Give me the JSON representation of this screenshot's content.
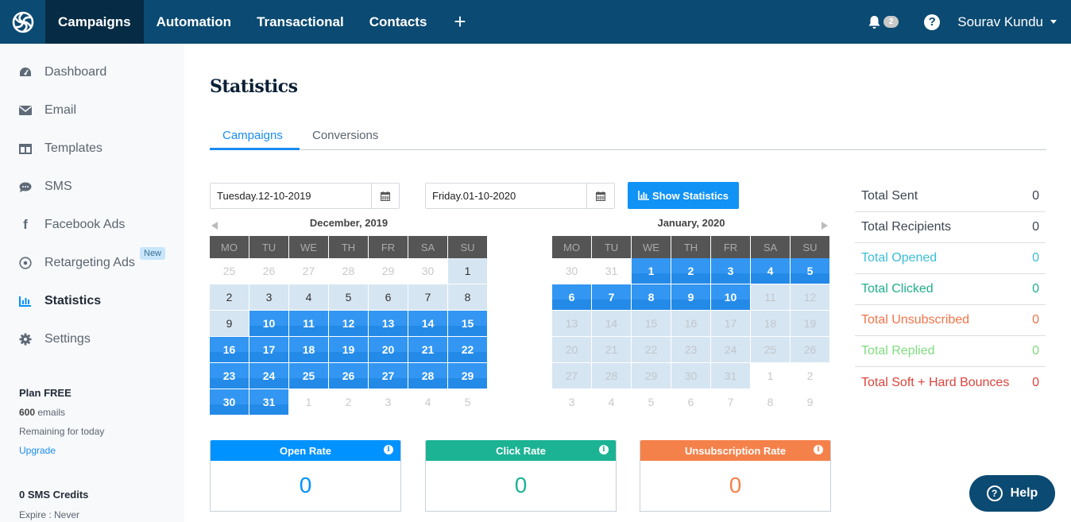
{
  "topnav": {
    "logo": "sendinblue-logo-icon",
    "items": [
      {
        "label": "Campaigns",
        "active": true
      },
      {
        "label": "Automation",
        "active": false
      },
      {
        "label": "Transactional",
        "active": false
      },
      {
        "label": "Contacts",
        "active": false
      }
    ],
    "plus_label": "+",
    "notification_count": "2",
    "user_name": "Sourav Kundu"
  },
  "sidebar": {
    "items": [
      {
        "label": "Dashboard",
        "icon": "dashboard-icon"
      },
      {
        "label": "Email",
        "icon": "envelope-icon"
      },
      {
        "label": "Templates",
        "icon": "templates-icon"
      },
      {
        "label": "SMS",
        "icon": "chat-icon"
      },
      {
        "label": "Facebook Ads",
        "icon": "facebook-icon"
      },
      {
        "label": "Retargeting Ads",
        "icon": "target-icon",
        "badge": "New"
      },
      {
        "label": "Statistics",
        "icon": "bar-chart-icon",
        "active": true
      },
      {
        "label": "Settings",
        "icon": "gear-icon"
      }
    ],
    "plan": {
      "title": "Plan FREE",
      "emails_count": "600",
      "emails_label": " emails",
      "remaining": "Remaining for today",
      "upgrade": "Upgrade"
    },
    "sms": {
      "title": "0 SMS Credits",
      "expire": "Expire : Never"
    }
  },
  "main": {
    "title": "Statistics",
    "tabs": [
      {
        "label": "Campaigns",
        "active": true
      },
      {
        "label": "Conversions",
        "active": false
      }
    ],
    "start_date": "Tuesday.12-10-2019",
    "end_date": "Friday.01-10-2020",
    "show_button": "Show Statistics",
    "calendars": [
      {
        "title": "December, 2019",
        "weekdays": [
          "MO",
          "TU",
          "WE",
          "TH",
          "FR",
          "SA",
          "SU"
        ],
        "days": [
          [
            "25",
            "other"
          ],
          [
            "26",
            "other"
          ],
          [
            "27",
            "other"
          ],
          [
            "28",
            "other"
          ],
          [
            "29",
            "other"
          ],
          [
            "30",
            "other"
          ],
          [
            "1",
            "range"
          ],
          [
            "2",
            "range"
          ],
          [
            "3",
            "range"
          ],
          [
            "4",
            "range"
          ],
          [
            "5",
            "range"
          ],
          [
            "6",
            "range"
          ],
          [
            "7",
            "range"
          ],
          [
            "8",
            "range"
          ],
          [
            "9",
            "range"
          ],
          [
            "10",
            "sel"
          ],
          [
            "11",
            "sel"
          ],
          [
            "12",
            "sel"
          ],
          [
            "13",
            "sel"
          ],
          [
            "14",
            "sel"
          ],
          [
            "15",
            "sel"
          ],
          [
            "16",
            "sel"
          ],
          [
            "17",
            "sel"
          ],
          [
            "18",
            "sel"
          ],
          [
            "19",
            "sel"
          ],
          [
            "20",
            "sel"
          ],
          [
            "21",
            "sel"
          ],
          [
            "22",
            "sel"
          ],
          [
            "23",
            "sel"
          ],
          [
            "24",
            "sel"
          ],
          [
            "25",
            "sel"
          ],
          [
            "26",
            "sel"
          ],
          [
            "27",
            "sel"
          ],
          [
            "28",
            "sel"
          ],
          [
            "29",
            "sel"
          ],
          [
            "30",
            "sel"
          ],
          [
            "31",
            "sel"
          ],
          [
            "1",
            "other"
          ],
          [
            "2",
            "other"
          ],
          [
            "3",
            "other"
          ],
          [
            "4",
            "other"
          ],
          [
            "5",
            "other"
          ]
        ]
      },
      {
        "title": "January, 2020",
        "weekdays": [
          "MO",
          "TU",
          "WE",
          "TH",
          "FR",
          "SA",
          "SU"
        ],
        "days": [
          [
            "30",
            "other"
          ],
          [
            "31",
            "other"
          ],
          [
            "1",
            "sel"
          ],
          [
            "2",
            "sel"
          ],
          [
            "3",
            "sel"
          ],
          [
            "4",
            "sel"
          ],
          [
            "5",
            "sel"
          ],
          [
            "6",
            "sel"
          ],
          [
            "7",
            "sel"
          ],
          [
            "8",
            "sel"
          ],
          [
            "9",
            "sel"
          ],
          [
            "10",
            "sel"
          ],
          [
            "11",
            "disabled"
          ],
          [
            "12",
            "disabled"
          ],
          [
            "13",
            "disabled"
          ],
          [
            "14",
            "disabled"
          ],
          [
            "15",
            "disabled"
          ],
          [
            "16",
            "disabled"
          ],
          [
            "17",
            "disabled"
          ],
          [
            "18",
            "disabled"
          ],
          [
            "19",
            "disabled"
          ],
          [
            "20",
            "disabled"
          ],
          [
            "21",
            "disabled"
          ],
          [
            "22",
            "disabled"
          ],
          [
            "23",
            "disabled"
          ],
          [
            "24",
            "disabled"
          ],
          [
            "25",
            "disabled"
          ],
          [
            "26",
            "disabled"
          ],
          [
            "27",
            "disabled"
          ],
          [
            "28",
            "disabled"
          ],
          [
            "29",
            "disabled"
          ],
          [
            "30",
            "disabled"
          ],
          [
            "31",
            "disabled"
          ],
          [
            "1",
            "other"
          ],
          [
            "2",
            "other"
          ],
          [
            "3",
            "other"
          ],
          [
            "4",
            "other"
          ],
          [
            "5",
            "other"
          ],
          [
            "6",
            "other"
          ],
          [
            "7",
            "other"
          ],
          [
            "8",
            "other"
          ],
          [
            "9",
            "other"
          ]
        ]
      }
    ],
    "stats": [
      {
        "label": "Total Sent",
        "value": "0",
        "color": "#3d4651"
      },
      {
        "label": "Total Recipients",
        "value": "0",
        "color": "#3d4651"
      },
      {
        "label": "Total Opened",
        "value": "0",
        "color": "#3bbdd4"
      },
      {
        "label": "Total Clicked",
        "value": "0",
        "color": "#1fae8e"
      },
      {
        "label": "Total Unsubscribed",
        "value": "0",
        "color": "#f0744a"
      },
      {
        "label": "Total Replied",
        "value": "0",
        "color": "#7fdc7f"
      },
      {
        "label": "Total Soft + Hard Bounces",
        "value": "0",
        "color": "#d9453d"
      }
    ],
    "rates": [
      {
        "label": "Open Rate",
        "value": "0",
        "color": "#0092ff"
      },
      {
        "label": "Click Rate",
        "value": "0",
        "color": "#1cb394"
      },
      {
        "label": "Unsubscription Rate",
        "value": "0",
        "color": "#f5814a"
      }
    ]
  },
  "help_button": "Help"
}
